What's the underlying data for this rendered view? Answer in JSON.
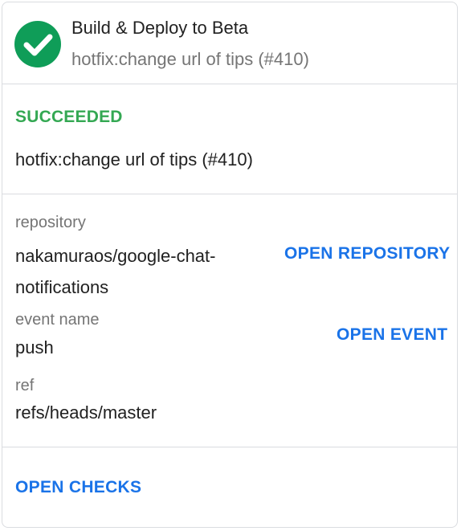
{
  "header": {
    "title": "Build & Deploy to Beta",
    "subtitle": "hotfix:change url of tips (#410)",
    "icon": "check-circle-icon",
    "icon_color": "#0f9d58"
  },
  "status": {
    "text": "SUCCEEDED",
    "color": "#34a853"
  },
  "message": "hotfix:change url of tips (#410)",
  "details": {
    "repository": {
      "label": "repository",
      "value": "nakamuraos/google-chat-notifications",
      "button_label": "OPEN REPOSITORY"
    },
    "event": {
      "label": "event name",
      "value": "push",
      "button_label": "OPEN EVENT"
    },
    "ref": {
      "label": "ref",
      "value": "refs/heads/master"
    }
  },
  "footer": {
    "button_label": "OPEN CHECKS"
  },
  "colors": {
    "link": "#1a73e8",
    "divider": "#dadce0"
  }
}
